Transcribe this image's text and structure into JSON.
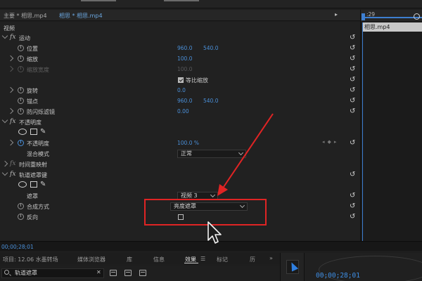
{
  "header": {
    "source_label": "主要 * 相思.mp4",
    "sequence_label": "相思 * 相思.mp4"
  },
  "timeline_panel": {
    "timecode": ":29",
    "clip_name": "相思.mp4"
  },
  "effect_controls": {
    "video_section": "视频",
    "motion": {
      "name": "运动",
      "position": {
        "label": "位置",
        "x": "960.0",
        "y": "540.0"
      },
      "scale": {
        "label": "缩放",
        "value": "100.0"
      },
      "scale_width": {
        "label": "缩放宽度",
        "value": "100.0"
      },
      "uniform_scale": {
        "label": "等比缩放",
        "checked": true
      },
      "rotation": {
        "label": "旋转",
        "value": "0.0"
      },
      "anchor": {
        "label": "锚点",
        "x": "960.0",
        "y": "540.0"
      },
      "anti_flicker": {
        "label": "防闪烁滤镜",
        "value": "0.00"
      }
    },
    "opacity": {
      "name": "不透明度",
      "opacity": {
        "label": "不透明度",
        "value": "100.0 %"
      },
      "blend_mode": {
        "label": "混合模式",
        "value": "正常"
      }
    },
    "time_remap": {
      "name": "时间重映射"
    },
    "track_matte": {
      "name": "轨道遮罩键",
      "matte": {
        "label": "遮罩",
        "value": "视频 3"
      },
      "composite": {
        "label": "合成方式",
        "value": "亮度遮罩"
      },
      "reverse": {
        "label": "反向",
        "checked": false
      }
    },
    "timecode": "00;00;28;01"
  },
  "bottom_panel": {
    "tabs": [
      "项目: 12.06 水墨转场",
      "媒体浏览器",
      "库",
      "信息",
      "效果",
      "标记",
      "历"
    ],
    "more_glyph": "»",
    "search_value": "轨道遮罩",
    "clear_glyph": "✕",
    "sequence_timecode": "00;00;28;01"
  },
  "colors": {
    "accent": "#4a8fd8",
    "annotation": "#e02424"
  }
}
